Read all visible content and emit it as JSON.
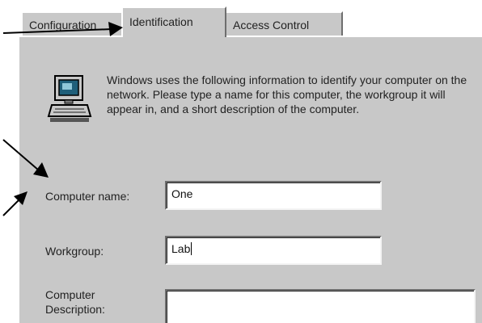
{
  "tabs": [
    {
      "label": "Configuration"
    },
    {
      "label": "Identification"
    },
    {
      "label": "Access Control"
    }
  ],
  "info_text": "Windows uses the following information to identify your computer on the network.  Please type a name for this computer, the workgroup it will appear in, and a short description of the computer.",
  "fields": {
    "computer_name": {
      "label": "Computer name:",
      "value": "One"
    },
    "workgroup": {
      "label": "Workgroup:",
      "value": "Lab"
    },
    "description": {
      "label_line1": "Computer",
      "label_line2": "Description:",
      "value": ""
    }
  },
  "icons": {
    "computer": "computer-icon",
    "arrows": [
      "arrow-pointer-icon",
      "arrow-pointer-icon",
      "arrow-pointer-icon"
    ]
  }
}
